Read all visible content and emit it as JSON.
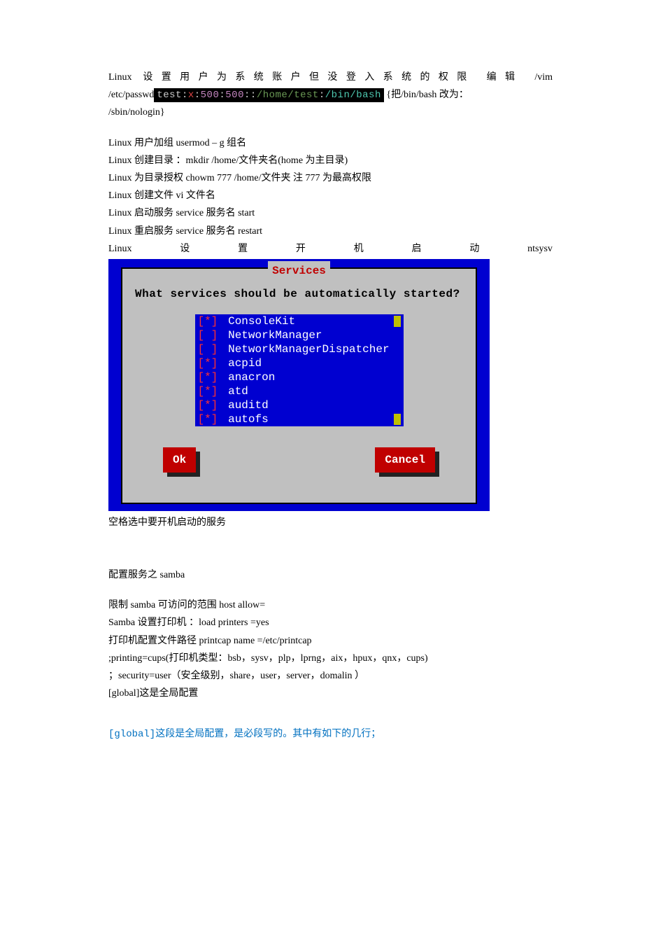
{
  "p1_prefix": "Linux  设置用户为系统账户但没登入系统的权限  编辑 /vim",
  "p1_before": "/etc/passwd",
  "passwd_line": {
    "user": "test",
    "sep1": ":",
    "x": "x",
    "sep2": ":",
    "uid": "500",
    "sep3": ":",
    "gid": "500",
    "sep4": "::",
    "home": "/home/test",
    "sep5": ":",
    "shell": "/bin/bash"
  },
  "p1_after_a": "  {把/bin/bash 改为：",
  "p1_after_b": "/sbin/nologin}",
  "cmds": {
    "usermod": "Linux  用户加组 usermod – g 组名",
    "mkdir": "Linux  创建目录 ：mkdir /home/文件夹名(home 为主目录)",
    "chown": "Linux 为目录授权 chowm 777 /home/文件夹 注 777 为最高权限",
    "vi": "Linux 创建文件 vi  文件名",
    "svc_start": "Linux 启动服务 service  服务名 start",
    "svc_restart": "Linux 重启服务 service  服务名 restart",
    "ntsysv_a": "Linux",
    "ntsysv_b": "设",
    "ntsysv_c": "置",
    "ntsysv_d": "开",
    "ntsysv_e": "机",
    "ntsysv_f": "启",
    "ntsysv_g": "动",
    "ntsysv_h": "ntsysv"
  },
  "tui": {
    "title": "Services",
    "question": "What services should be automatically started?",
    "items": [
      {
        "sel": true,
        "label": "ConsoleKit",
        "bar": true
      },
      {
        "sel": false,
        "label": "NetworkManager",
        "bar": false
      },
      {
        "sel": false,
        "label": "NetworkManagerDispatcher",
        "bar": false
      },
      {
        "sel": true,
        "label": "acpid",
        "bar": false
      },
      {
        "sel": true,
        "label": "anacron",
        "bar": false
      },
      {
        "sel": true,
        "label": "atd",
        "bar": false
      },
      {
        "sel": true,
        "label": "auditd",
        "bar": false
      },
      {
        "sel": true,
        "label": "autofs",
        "bar": true
      }
    ],
    "ok": "Ok",
    "cancel": "Cancel"
  },
  "after_tui": "空格选中要开机启动的服务",
  "samba_h": "配置服务之 samba",
  "samba": {
    "l1": "限制 samba 可访问的范围 host allow=",
    "l2": "Samba 设置打印机 ：load printers =yes",
    "l3": "打印机配置文件路径 printcap name =/etc/printcap",
    "l4": ";printing=cups(打印机类型：bsb，sysv，plp，lprng，aix，hpux，qnx，cups)",
    "l5": "；security=user（安全级别，share，user，server，domalin ）",
    "l6": "[global]这是全局配置"
  },
  "global_line": "[global]这段是全局配置，是必段写的。其中有如下的几行；"
}
